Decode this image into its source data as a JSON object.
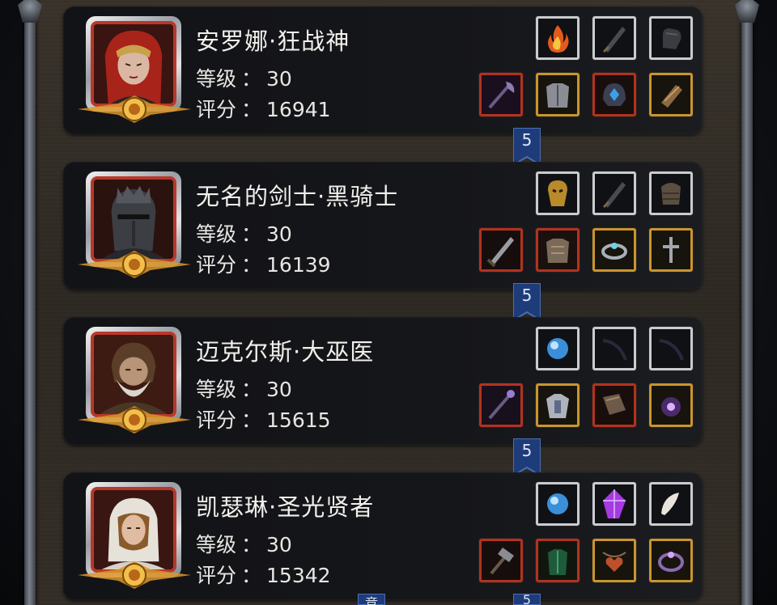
{
  "labels": {
    "level": "等级",
    "score": "评分",
    "colon": "："
  },
  "heroes": [
    {
      "name": "安罗娜·狂战神",
      "level": "30",
      "score": "16941",
      "badge": "5",
      "portrait_icon": "red-haired-warrior-woman-portrait",
      "top_row": [
        {
          "icon": "fire-orb-icon",
          "rarity": "silver"
        },
        {
          "icon": "dark-blade-icon",
          "rarity": "silver"
        },
        {
          "icon": "gauntlet-icon",
          "rarity": "silver"
        }
      ],
      "bottom_row": [
        {
          "icon": "halberd-icon",
          "rarity": "red"
        },
        {
          "icon": "plate-armor-icon",
          "rarity": "gold"
        },
        {
          "icon": "blue-gem-helm-icon",
          "rarity": "red"
        },
        {
          "icon": "bracer-icon",
          "rarity": "gold"
        }
      ]
    },
    {
      "name": "无名的剑士·黑骑士",
      "level": "30",
      "score": "16139",
      "badge": "5",
      "portrait_icon": "black-knight-helmet-portrait",
      "top_row": [
        {
          "icon": "golden-mask-icon",
          "rarity": "silver"
        },
        {
          "icon": "dark-blade-icon",
          "rarity": "silver"
        },
        {
          "icon": "pauldron-icon",
          "rarity": "silver"
        }
      ],
      "bottom_row": [
        {
          "icon": "greatsword-icon",
          "rarity": "red"
        },
        {
          "icon": "chest-armor-icon",
          "rarity": "red"
        },
        {
          "icon": "silver-ring-icon",
          "rarity": "gold"
        },
        {
          "icon": "cross-amulet-icon",
          "rarity": "gold"
        }
      ]
    },
    {
      "name": "迈克尔斯·大巫医",
      "level": "30",
      "score": "15615",
      "badge": "5",
      "portrait_icon": "bearded-shaman-portrait",
      "top_row": [
        {
          "icon": "blue-orb-icon",
          "rarity": "silver"
        },
        {
          "icon": "dark-arc-icon",
          "rarity": "silver"
        },
        {
          "icon": "dark-arc-icon",
          "rarity": "silver"
        }
      ],
      "bottom_row": [
        {
          "icon": "ornate-staff-icon",
          "rarity": "red"
        },
        {
          "icon": "shoulder-armor-icon",
          "rarity": "gold"
        },
        {
          "icon": "tome-icon",
          "rarity": "red"
        },
        {
          "icon": "purple-eye-amulet-icon",
          "rarity": "gold"
        }
      ]
    },
    {
      "name": "凯瑟琳·圣光贤者",
      "level": "30",
      "score": "15342",
      "badge": "5",
      "portrait_icon": "hooded-sage-woman-portrait",
      "top_row": [
        {
          "icon": "blue-orb-icon",
          "rarity": "silver"
        },
        {
          "icon": "purple-crystal-icon",
          "rarity": "silver"
        },
        {
          "icon": "white-feather-icon",
          "rarity": "silver"
        }
      ],
      "bottom_row": [
        {
          "icon": "hammer-icon",
          "rarity": "red"
        },
        {
          "icon": "green-robe-icon",
          "rarity": "red"
        },
        {
          "icon": "heart-pendant-icon",
          "rarity": "gold"
        },
        {
          "icon": "purple-ring-icon",
          "rarity": "gold"
        }
      ]
    }
  ],
  "partial_bottom_text": "竞",
  "partial_bottom_badge": "5",
  "colors": {
    "silver": "#c9cbd0",
    "gold": "#c9952e",
    "red": "#b3321f",
    "bookmark": "#1e3c7a"
  }
}
